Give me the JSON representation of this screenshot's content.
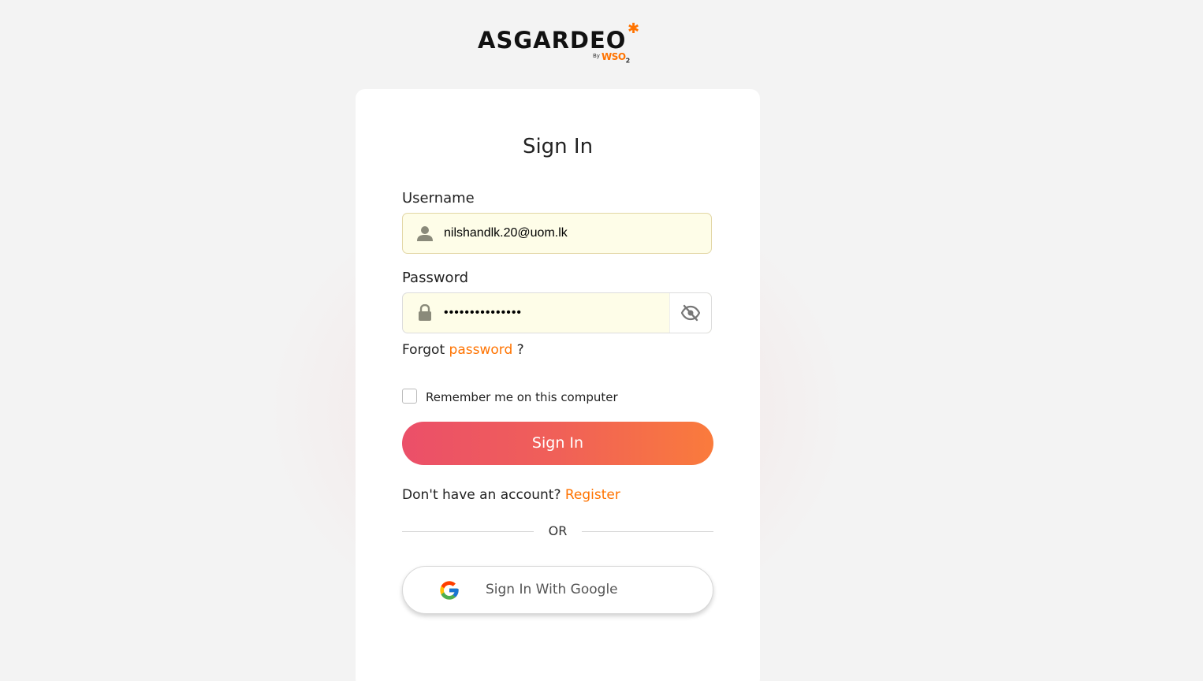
{
  "brand": {
    "name": "ASGARDEO",
    "by": "By",
    "vendor": "WSO",
    "vendor_sub": "2",
    "accent_color": "#ff7300"
  },
  "form": {
    "title": "Sign In",
    "username": {
      "label": "Username",
      "value": "nilshandlk.20@uom.lk",
      "icon": "user-icon"
    },
    "password": {
      "label": "Password",
      "value": "•••••••••••••••",
      "icon": "lock-icon",
      "toggle_icon": "eye-slash-icon"
    },
    "forgot": {
      "prefix": "Forgot",
      "link": "password",
      "suffix": "?"
    },
    "remember_me": {
      "label": "Remember me on this computer",
      "checked": false
    },
    "submit_label": "Sign In",
    "register": {
      "prompt": "Don't have an account?",
      "link": "Register"
    },
    "divider_text": "OR",
    "google": {
      "label": "Sign In With Google",
      "icon": "google-icon"
    }
  },
  "colors": {
    "button_gradient_start": "#eb4f69",
    "button_gradient_end": "#fa7b3c",
    "link": "#ff7300"
  }
}
